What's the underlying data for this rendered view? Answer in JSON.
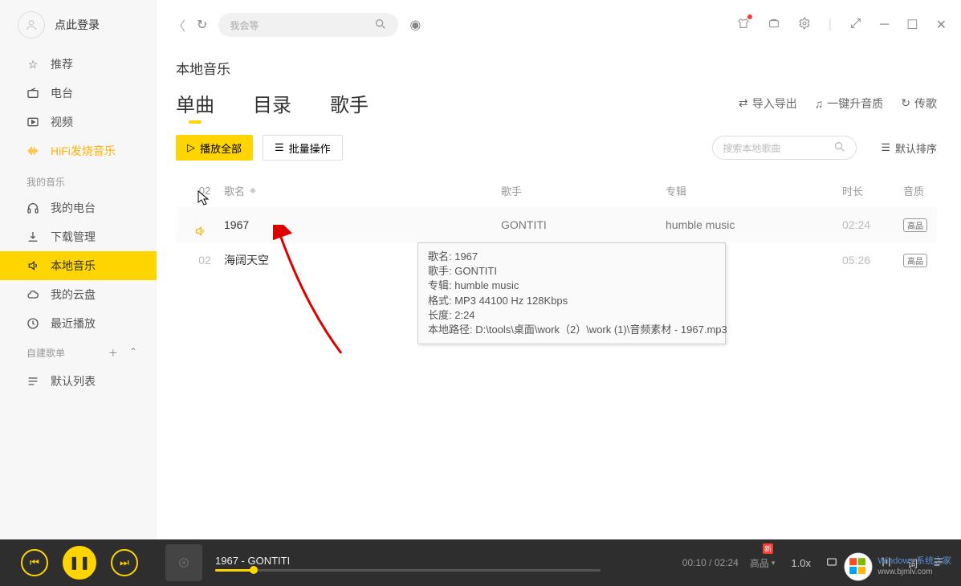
{
  "sidebar": {
    "login": "点此登录",
    "nav1": [
      {
        "icon": "star",
        "label": "推荐"
      },
      {
        "icon": "radio",
        "label": "电台"
      },
      {
        "icon": "video",
        "label": "视频"
      },
      {
        "icon": "hifi",
        "label": "HiFi发烧音乐"
      }
    ],
    "section_my": "我的音乐",
    "nav2": [
      {
        "icon": "radio",
        "label": "我的电台"
      },
      {
        "icon": "download",
        "label": "下载管理"
      },
      {
        "icon": "speaker",
        "label": "本地音乐",
        "active": true
      },
      {
        "icon": "cloud",
        "label": "我的云盘"
      },
      {
        "icon": "clock",
        "label": "最近播放"
      }
    ],
    "section_playlist": "自建歌单",
    "nav3": [
      {
        "icon": "list",
        "label": "默认列表"
      }
    ]
  },
  "titlebar": {
    "search_placeholder": "我会等"
  },
  "page": {
    "title": "本地音乐",
    "tabs": [
      "单曲",
      "目录",
      "歌手"
    ],
    "actions": {
      "impexp": "导入导出",
      "upgrade": "一键升音质",
      "transfer": "传歌"
    },
    "play_all": "播放全部",
    "batch": "批量操作",
    "search_placeholder": "搜索本地歌曲",
    "sort": "默认排序",
    "columns": {
      "idx": "02",
      "name": "歌名",
      "artist": "歌手",
      "album": "专辑",
      "dur": "时长",
      "q": "音质"
    },
    "rows": [
      {
        "idx": "",
        "playing": true,
        "name": "1967",
        "artist": "GONTITI",
        "album": "humble music",
        "dur": "02:24",
        "q": "高品"
      },
      {
        "idx": "02",
        "playing": false,
        "name": "海阔天空",
        "artist": "",
        "album": "",
        "dur": "05:26",
        "q": "高品"
      }
    ]
  },
  "tooltip": {
    "l1": "歌名:   1967",
    "l2": "歌手:   GONTITI",
    "l3": "专辑:   humble music",
    "l4": "格式:   MP3  44100 Hz  128Kbps",
    "l5": "长度:   2:24",
    "l6": "本地路径:   D:\\tools\\桌面\\work（2）\\work (1)\\音频素材 - 1967.mp3"
  },
  "player": {
    "track": "1967 - GONTITI",
    "cur": "00:10",
    "total": "02:24",
    "quality": "高品",
    "speed": "1.0x",
    "progress_pct": "10%"
  },
  "watermark": {
    "title": "Windows 系统之家",
    "url": "www.bjmlv.com"
  }
}
